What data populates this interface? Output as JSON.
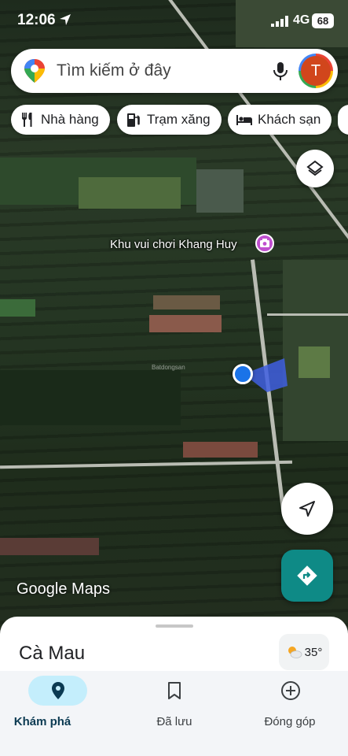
{
  "status_bar": {
    "time": "12:06",
    "network": "4G",
    "battery": "68"
  },
  "search": {
    "placeholder": "Tìm kiếm ở đây",
    "avatar_letter": "T"
  },
  "chips": [
    {
      "label": "Nhà hàng",
      "icon": "restaurant-icon"
    },
    {
      "label": "Trạm xăng",
      "icon": "gas-station-icon"
    },
    {
      "label": "Khách sạn",
      "icon": "hotel-icon"
    }
  ],
  "map": {
    "poi_label": "Khu vui chơi Khang Huy",
    "poi_icon": "camera-icon",
    "watermark": "Batdongsan",
    "logo": "Google Maps"
  },
  "sheet": {
    "place_name": "Cà Mau",
    "temperature": "35°",
    "weather_icon": "partly-sunny-icon"
  },
  "bottom_nav": {
    "items": [
      {
        "label": "Khám phá",
        "icon": "explore-pin-icon",
        "active": true
      },
      {
        "label": "Đã lưu",
        "icon": "bookmark-icon",
        "active": false
      },
      {
        "label": "Đóng góp",
        "icon": "add-circle-icon",
        "active": false
      }
    ]
  },
  "colors": {
    "accent_teal": "#0e8a86",
    "location_blue": "#1a73e8",
    "nav_active_bg": "#c4eefc"
  }
}
